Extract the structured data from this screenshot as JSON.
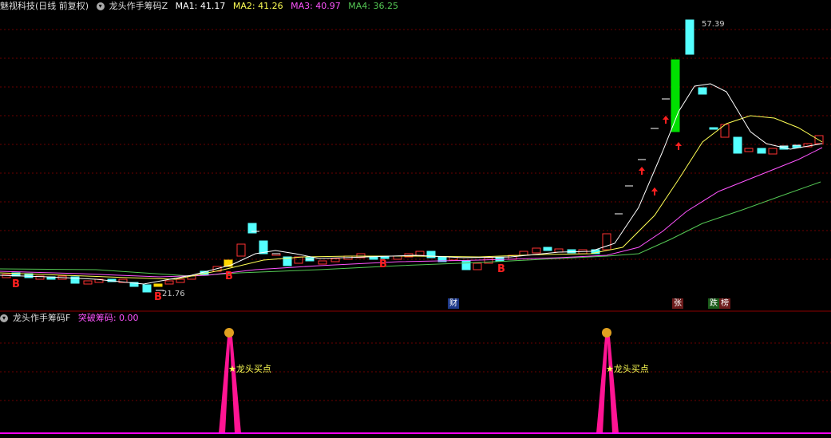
{
  "header": {
    "stock_name": "魅视科技",
    "period": "(日线 前复权)",
    "indicator": "龙头作手筹码Z",
    "ma1": "MA1: 41.17",
    "ma2": "MA2: 41.26",
    "ma3": "MA3: 40.97",
    "ma4": "MA4: 36.25"
  },
  "price_labels": {
    "high": "57.39",
    "low": "21.76"
  },
  "event_tags": {
    "cai": "财",
    "zhang": "张",
    "die": "跌",
    "bang": "榜"
  },
  "sub": {
    "indicator": "龙头作手筹码F",
    "value": "突破筹码: 0.00",
    "signal_label": "★龙头买点"
  },
  "colors": {
    "up": "#ff3232",
    "down": "#54ffff",
    "ma1": "#ffffff",
    "ma2": "#ffff54",
    "ma3": "#ff54ff",
    "ma4": "#54c854",
    "signal": "#ff1493",
    "grid": "#8b0000"
  }
}
